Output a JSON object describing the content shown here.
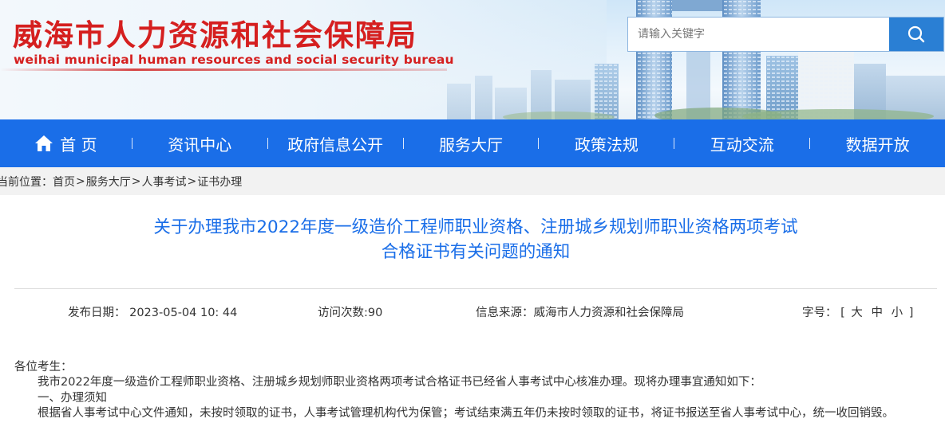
{
  "header": {
    "logo_cn": "威海市人力资源和社会保障局",
    "logo_en": "weihai municipal human resources and social security bureau",
    "search": {
      "placeholder": "请输入关键字",
      "icon": "search-icon"
    }
  },
  "nav": {
    "items": [
      {
        "label": "首 页",
        "icon": "home-icon"
      },
      {
        "label": "资讯中心"
      },
      {
        "label": "政府信息公开"
      },
      {
        "label": "服务大厅"
      },
      {
        "label": "政策法规"
      },
      {
        "label": "互动交流"
      },
      {
        "label": "数据开放"
      }
    ]
  },
  "breadcrumb": {
    "prefix": "当前位置：",
    "items": [
      "首页",
      "服务大厅",
      "人事考试",
      "证书办理"
    ],
    "separator": ">"
  },
  "article": {
    "title_line1": "关于办理我市2022年度一级造价工程师职业资格、注册城乡规划师职业资格两项考试",
    "title_line2": "合格证书有关问题的通知",
    "meta": {
      "date": "发布日期：  2023-05-04 10: 44",
      "visits": "访问次数:90",
      "source": "信息来源：威海市人力资源和社会保障局",
      "font_label": "字号：",
      "font_open": "[",
      "font_large": "大",
      "font_medium": "中",
      "font_small": "小",
      "font_close": "]"
    },
    "salutation": "各位考生：",
    "para1": "我市2022年度一级造价工程师职业资格、注册城乡规划师职业资格两项考试合格证书已经省人事考试中心核准办理。现将办理事宜通知如下：",
    "section1": "一、办理须知",
    "para2": "根据省人事考试中心文件通知，未按时领取的证书，人事考试管理机构代为保管；考试结束满五年仍未按时领取的证书，将证书报送至省人事考试中心，统一收回销毁。"
  },
  "colors": {
    "brand_red": "#d51f1f",
    "nav_blue": "#1a6ee8",
    "title_blue": "#1a6ee8",
    "search_button": "#2a7fd4"
  }
}
